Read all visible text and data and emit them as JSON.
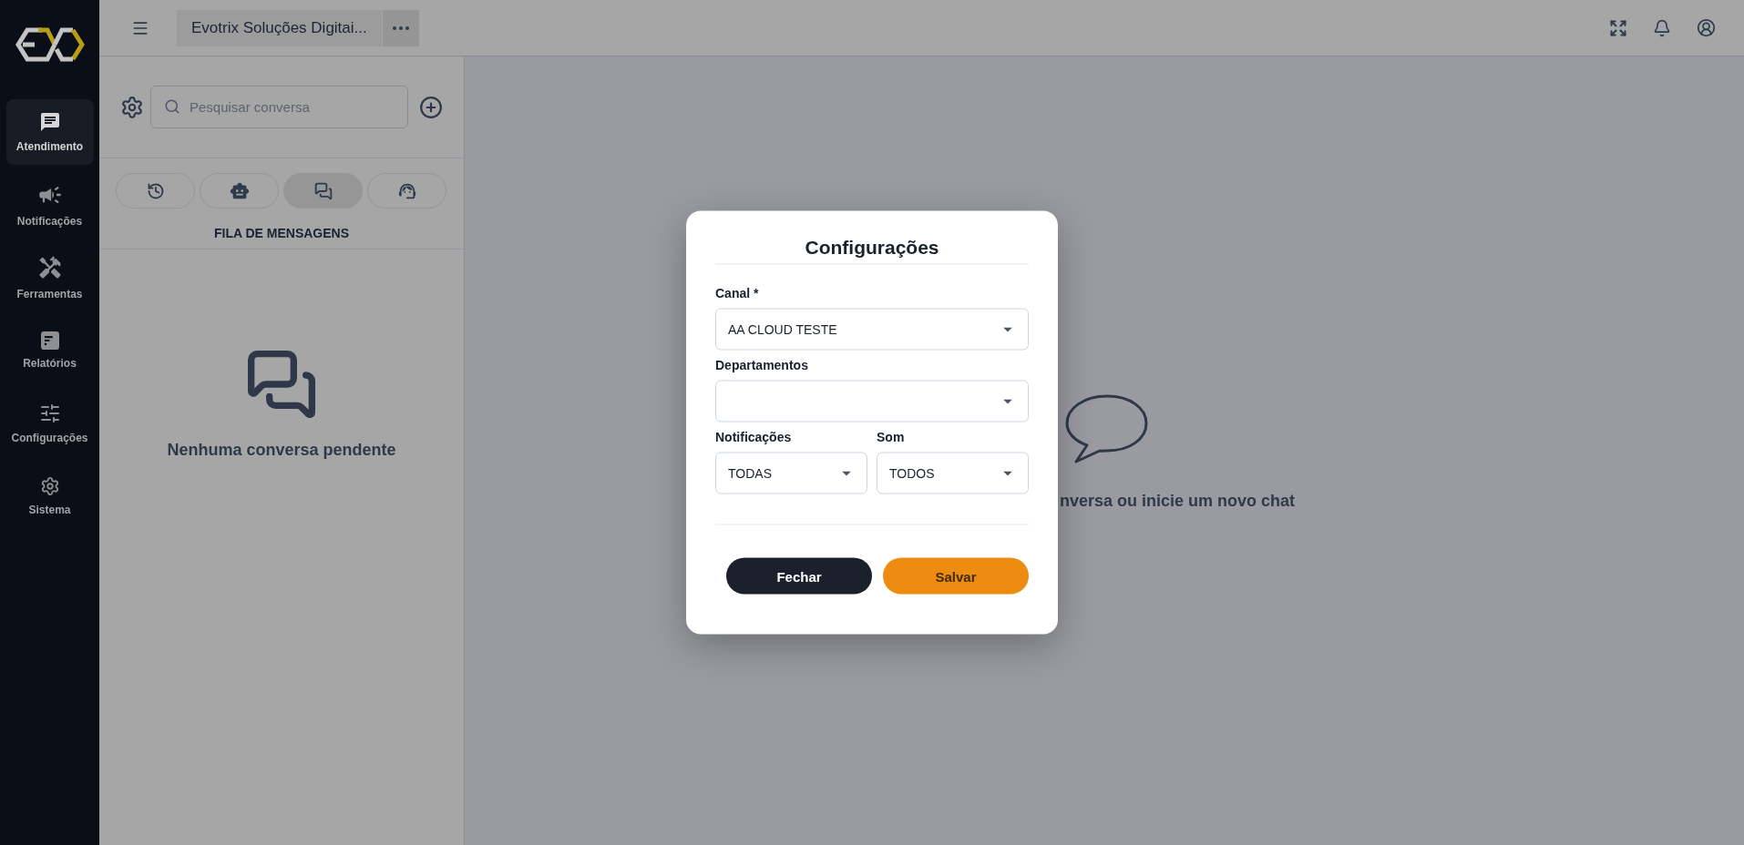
{
  "sidebar": {
    "items": [
      {
        "label": "Atendimento",
        "selected": true
      },
      {
        "label": "Notificações",
        "selected": false
      },
      {
        "label": "Ferramentas",
        "selected": false
      },
      {
        "label": "Relatórios",
        "selected": false
      },
      {
        "label": "Configurações",
        "selected": false
      },
      {
        "label": "Sistema",
        "selected": false
      }
    ]
  },
  "top_bar": {
    "document_tab": {
      "title": "Evotrix Soluções Digitai..."
    }
  },
  "conversation_panel": {
    "search": {
      "placeholder": "Pesquisar conversa"
    },
    "tabs": [
      {
        "selected": false
      },
      {
        "selected": false
      },
      {
        "selected": true
      },
      {
        "selected": false
      }
    ],
    "queue_title": "FILA DE MENSAGENS",
    "empty_message": "Nenhuma conversa pendente"
  },
  "chat_area": {
    "empty_message": "nversa ou inicie um novo chat"
  },
  "dialog": {
    "title": "Configurações",
    "rows": [
      {
        "fields": [
          {
            "label": "Canal *",
            "value": "AA CLOUD TESTE"
          }
        ]
      },
      {
        "fields": [
          {
            "label": "Departamentos"
          }
        ]
      },
      {
        "fields": [
          {
            "label": "Notificações",
            "value": "TODAS"
          },
          {
            "label": "Som",
            "value": "TODOS"
          }
        ]
      }
    ],
    "buttons": [
      {
        "label": "Fechar",
        "kind": "secondary"
      },
      {
        "label": "Salvar",
        "kind": "primary"
      }
    ]
  }
}
